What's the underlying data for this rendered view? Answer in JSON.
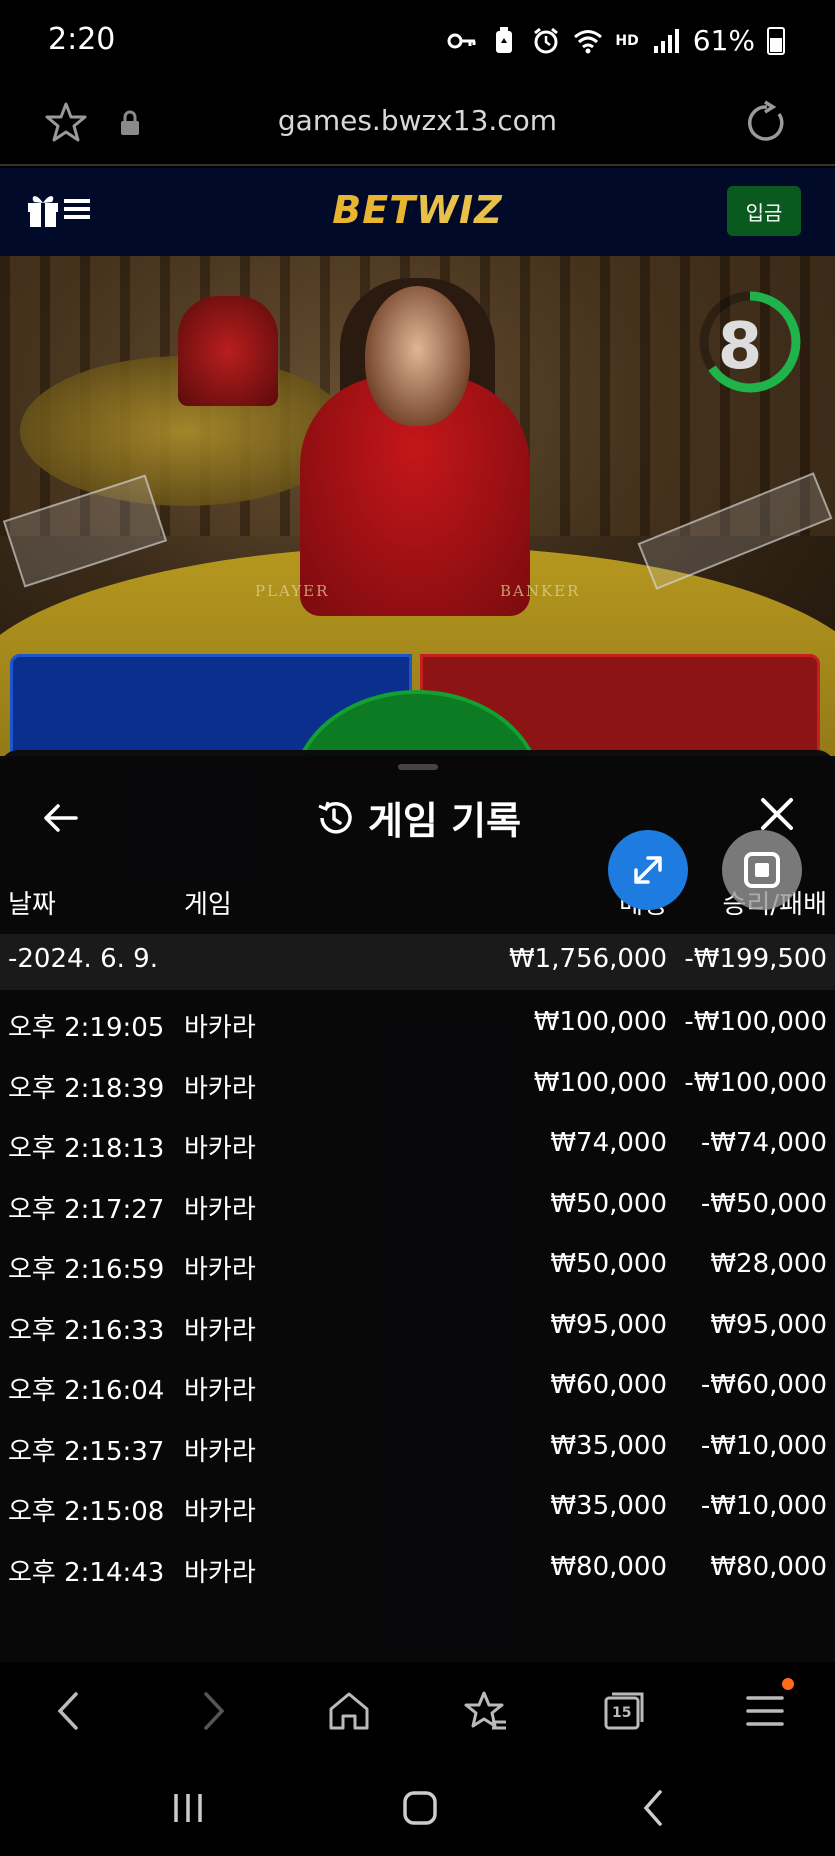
{
  "status_bar": {
    "time": "2:20",
    "battery": "61%",
    "network_badge": "HD"
  },
  "browser": {
    "url": "games.bwzx13.com",
    "tabs_count": "15"
  },
  "site": {
    "logo_bet": "BET",
    "logo_wiz": "WIZ",
    "deposit_label": "입금"
  },
  "video": {
    "countdown": "8",
    "player_label": "PLAYER",
    "banker_label": "BANKER"
  },
  "history": {
    "title": "게임 기록",
    "columns": {
      "date": "날짜",
      "game": "게임",
      "bet": "베팅",
      "result": "승리/패배"
    },
    "summary": {
      "date": "-2024. 6. 9.",
      "bet": "₩1,756,000",
      "result": "-₩199,500"
    },
    "rows": [
      {
        "time": "오후 2:19:05",
        "game": "바카라",
        "bet": "₩100,000",
        "result": "-₩100,000"
      },
      {
        "time": "오후 2:18:39",
        "game": "바카라",
        "bet": "₩100,000",
        "result": "-₩100,000"
      },
      {
        "time": "오후 2:18:13",
        "game": "바카라",
        "bet": "₩74,000",
        "result": "-₩74,000"
      },
      {
        "time": "오후 2:17:27",
        "game": "바카라",
        "bet": "₩50,000",
        "result": "-₩50,000"
      },
      {
        "time": "오후 2:16:59",
        "game": "바카라",
        "bet": "₩50,000",
        "result": "₩28,000"
      },
      {
        "time": "오후 2:16:33",
        "game": "바카라",
        "bet": "₩95,000",
        "result": "₩95,000"
      },
      {
        "time": "오후 2:16:04",
        "game": "바카라",
        "bet": "₩60,000",
        "result": "-₩60,000"
      },
      {
        "time": "오후 2:15:37",
        "game": "바카라",
        "bet": "₩35,000",
        "result": "-₩10,000"
      },
      {
        "time": "오후 2:15:08",
        "game": "바카라",
        "bet": "₩35,000",
        "result": "-₩10,000"
      },
      {
        "time": "오후 2:14:43",
        "game": "바카라",
        "bet": "₩80,000",
        "result": "₩80,000"
      }
    ]
  },
  "colors": {
    "header_bg": "#020a2a",
    "logo_gold": "#e8b530",
    "deposit_green": "#0a5a20",
    "player_blue": "#0a2f8c",
    "banker_red": "#8c1414",
    "tie_green": "#0d7a24",
    "fab_blue": "#1e7be0",
    "notif_orange": "#ff6a1a"
  }
}
